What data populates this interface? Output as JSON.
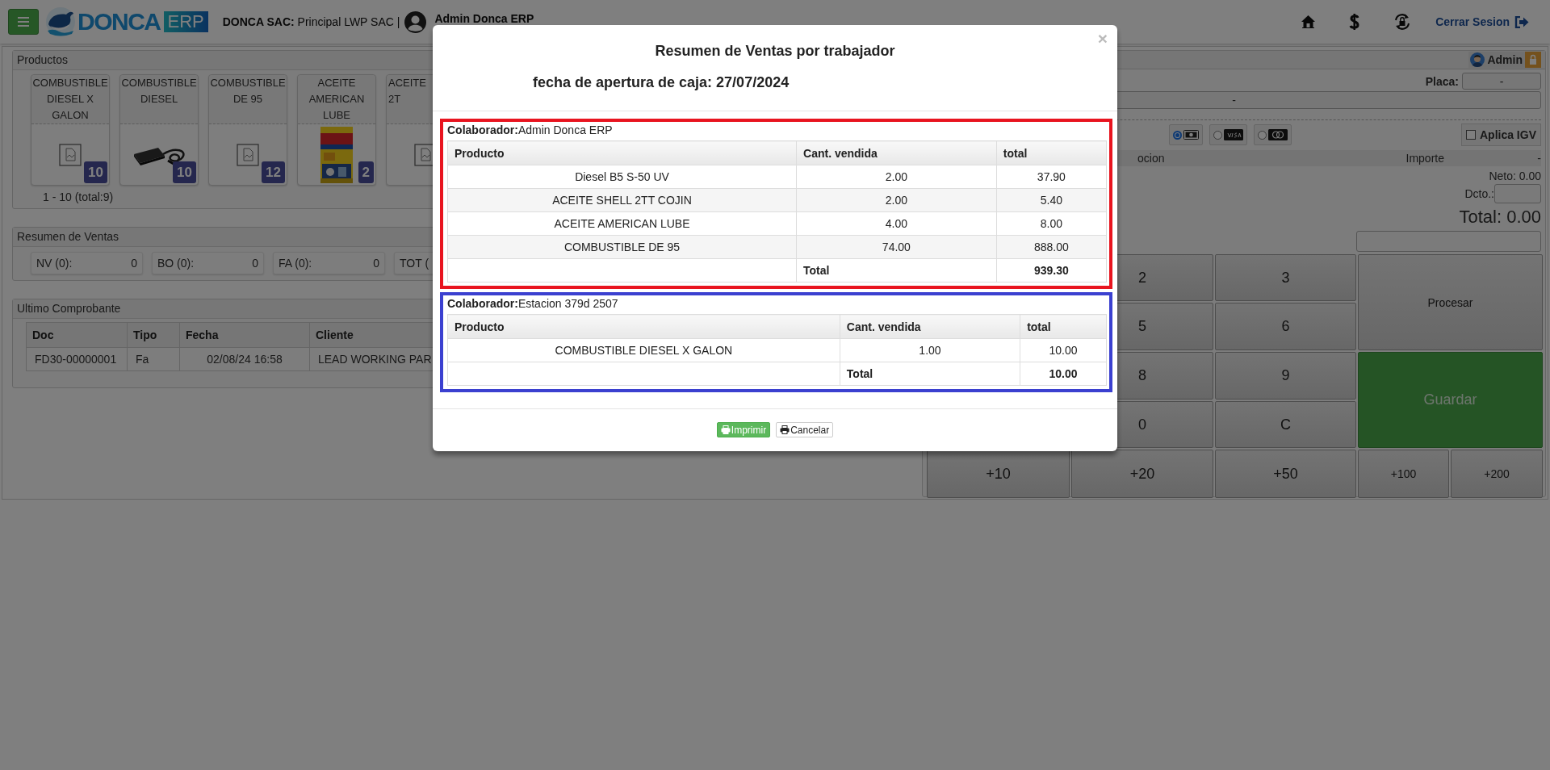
{
  "header": {
    "brand": "DONCA",
    "brand_tag": "ERP",
    "company": "**DONCA SAC:** Principal LWP SAC |",
    "user": "Admin Donca ERP",
    "logout": "Cerrar Sesion"
  },
  "products": {
    "title": "Productos",
    "items": [
      {
        "name": "COMBUSTIBLE DIESEL X GALON",
        "kind": "placeholder",
        "count": "10"
      },
      {
        "name": "COMBUSTIBLE DIESEL",
        "kind": "picture",
        "count": "10"
      },
      {
        "name": "COMBUSTIBLE DE 95",
        "kind": "placeholder",
        "count": "12"
      },
      {
        "name": "ACEITE AMERICAN LUBE",
        "kind": "picture",
        "count": "2"
      },
      {
        "name": "ACEITE\n2T",
        "kind": "placeholder",
        "cut": true
      }
    ],
    "pager": "1 - 10 (total:9)"
  },
  "sales_summary": {
    "title": "Resumen de Ventas",
    "items": [
      {
        "label": "NV (0):",
        "value": "0"
      },
      {
        "label": "BO (0):",
        "value": "0"
      },
      {
        "label": "FA (0):",
        "value": "0"
      },
      {
        "label": "TOT ("
      }
    ]
  },
  "last_receipt": {
    "title": "Ultimo Comprobante",
    "columns": [
      "Doc",
      "Tipo",
      "Fecha",
      "Cliente"
    ],
    "rows": [
      [
        "FD30-00000001",
        "Fa",
        "02/08/24 16:58",
        "LEAD WORKING PAR"
      ]
    ]
  },
  "sale_panel": {
    "user": "Admin",
    "plate_label": "Placa:",
    "plate_value": "-",
    "client_value": "-",
    "payment_methods": [
      {
        "kind": "cash",
        "selected": true
      },
      {
        "kind": "visa",
        "selected": false
      },
      {
        "kind": "mastercard",
        "selected": false
      }
    ],
    "igv": {
      "label": "Aplica IGV",
      "checked": false
    },
    "columns": [
      "ocion",
      "Importe",
      "-"
    ],
    "net": "Neto: 0.00",
    "discount_label": "Dcto.:",
    "total": "Total: 0.00",
    "keypad": {
      "rows": [
        [
          "2",
          "3"
        ],
        [
          "5",
          "6"
        ],
        [
          "8",
          "9"
        ],
        [
          "0",
          "C"
        ]
      ],
      "side": [
        {
          "label": "Procesar",
          "kind": "default"
        },
        {
          "label": "Guardar",
          "kind": "success"
        }
      ],
      "bottom": [
        "+10",
        "+20",
        "+50",
        "+100",
        "+200"
      ]
    }
  },
  "modal": {
    "title": "Resumen de Ventas por trabajador",
    "opening": "fecha de apertura de caja: 27/07/2024",
    "close": "×",
    "groups": [
      {
        "heading": "**Colaborador:**Admin Donca ERP",
        "color": "#e8141f",
        "columns": [
          "Producto",
          "Cant. vendida",
          "total"
        ],
        "rows": [
          [
            "Diesel B5 S-50 UV",
            "2.00",
            "37.90"
          ],
          [
            "ACEITE SHELL 2TT COJIN",
            "2.00",
            "5.40"
          ],
          [
            "ACEITE AMERICAN LUBE",
            "4.00",
            "8.00"
          ],
          [
            "COMBUSTIBLE DE 95",
            "74.00",
            "888.00"
          ]
        ],
        "total_label": "Total",
        "total_value": "939.30"
      },
      {
        "heading": "**Colaborador:**Estacion 379d 2507",
        "color": "#3b40d0",
        "columns": [
          "Producto",
          "Cant. vendida",
          "total"
        ],
        "rows": [
          [
            "COMBUSTIBLE DIESEL X GALON",
            "1.00",
            "10.00"
          ]
        ],
        "total_label": "Total",
        "total_value": "10.00"
      }
    ],
    "buttons": [
      {
        "label": "Imprimir",
        "kind": "success"
      },
      {
        "label": "Cancelar",
        "kind": "default"
      }
    ]
  }
}
